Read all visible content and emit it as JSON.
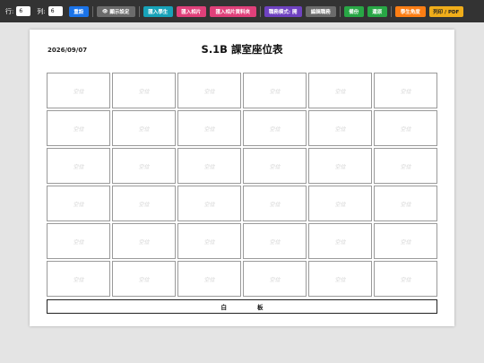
{
  "toolbar": {
    "rows_label": "行:",
    "rows_value": "6",
    "cols_label": "列:",
    "cols_value": "6",
    "buttons": [
      {
        "label": "重設",
        "color": "#1a73e8"
      },
      {
        "label": "顯示設定",
        "color": "#6b6b6b",
        "icon": "eye-icon"
      },
      {
        "label": "匯入學生",
        "color": "#17a2b8"
      },
      {
        "label": "匯入相片",
        "color": "#e0407a"
      },
      {
        "label": "匯入相片資料夾",
        "color": "#e0407a"
      },
      {
        "label": "職務模式: 開",
        "color": "#6f42c1"
      },
      {
        "label": "編輯職務",
        "color": "#6b6b6b"
      },
      {
        "label": "備份",
        "color": "#28a745"
      },
      {
        "label": "還原",
        "color": "#28a745"
      },
      {
        "label": "學生角度",
        "color": "#fd7e14"
      },
      {
        "label": "列印 / PDF",
        "color": "#f0ad1a"
      }
    ]
  },
  "sheet": {
    "date": "2026/09/07",
    "title": "S.1B 課室座位表",
    "seat_placeholder": "空位",
    "board_left": "白",
    "board_right": "板"
  },
  "grid": {
    "rows": 6,
    "cols": 6
  }
}
